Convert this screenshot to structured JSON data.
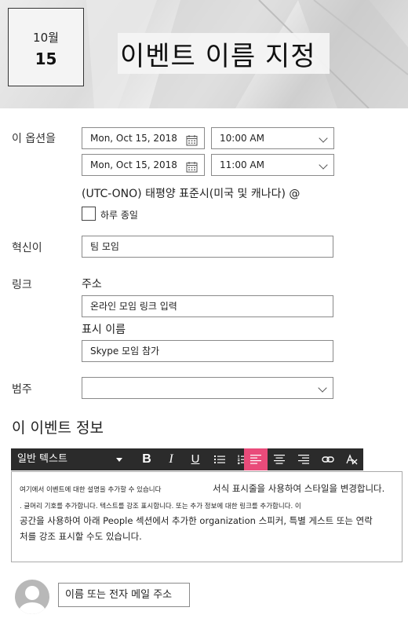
{
  "header": {
    "date_month": "10월",
    "date_day": "15",
    "event_title": "이벤트 이름 지정"
  },
  "when": {
    "label": "이 옵션을",
    "start_date": "Mon, Oct 15, 2018",
    "start_time": "10:00 AM",
    "end_date": "Mon, Oct 15, 2018",
    "end_time": "11:00 AM",
    "timezone": "(UTC-ONO) 태평양 표준시(미국 및 캐나다) @",
    "all_day_label": "하루 종일",
    "all_day_checked": false
  },
  "location": {
    "label": "혁신이",
    "value": "팀 모임"
  },
  "link": {
    "label": "링크",
    "address_label": "주소",
    "address_placeholder": "온라인 모임 링크 입력",
    "display_label": "표시 이름",
    "display_value": "Skype 모임 참가"
  },
  "category": {
    "label": "범주",
    "value": ""
  },
  "about": {
    "title": "이 이벤트 정보"
  },
  "toolbar": {
    "style_select": "일반 텍스트",
    "bold": "B",
    "italic": "I",
    "underline": "U"
  },
  "editor": {
    "line1a": "여기에서 이벤트에 대한 설명을 추가할 수 있습니다",
    "line1b": "서식 표시줄을 사용하여 스타일을 변경합니다.",
    "line2": ". 글머리 기호를 추가합니다. 텍스트를 강조 표시합니다. 또는 추가 정보에 대한 링크를 추가합니다. 이",
    "line3": "공간을 사용하여 아래 People 섹션에서 추가한 organization 스피커, 특별 게스트 또는 연락",
    "line4": "처를 강조 표시할 수도 있습니다."
  },
  "people": {
    "placeholder": "이름 또는 전자 메일 주소"
  },
  "colors": {
    "toolbar_bg": "#2b2b2b",
    "active_button": "#e94b7a"
  }
}
